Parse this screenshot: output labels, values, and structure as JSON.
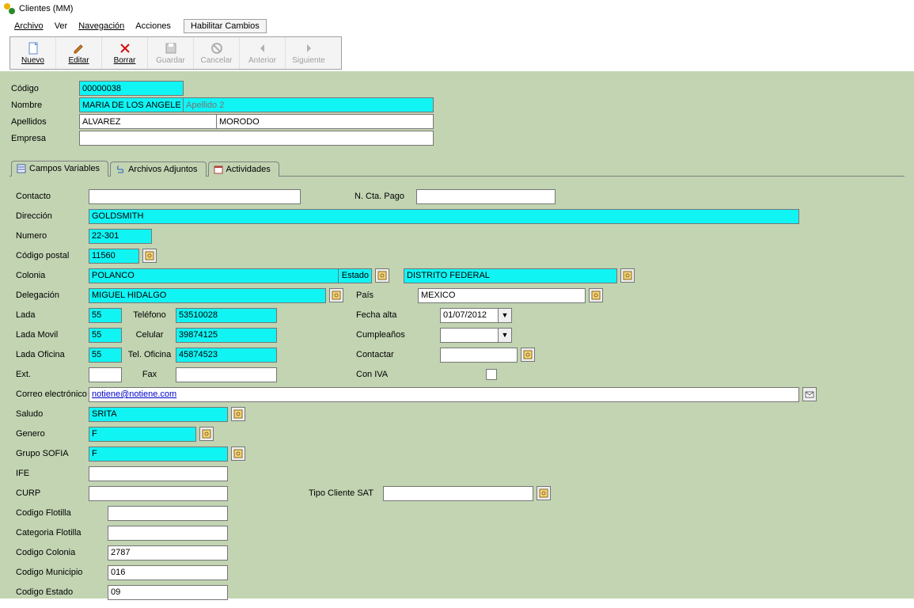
{
  "window": {
    "title": "Clientes (MM)"
  },
  "menu": {
    "archivo": "Archivo",
    "ver": "Ver",
    "navegacion": "Navegación",
    "acciones": "Acciones",
    "habilitar": "Habilitar Cambios"
  },
  "toolbar": {
    "nuevo": "Nuevo",
    "editar": "Editar",
    "borrar": "Borrar",
    "guardar": "Guardar",
    "cancelar": "Cancelar",
    "anterior": "Anterior",
    "siguiente": "Siguiente"
  },
  "header": {
    "codigo_label": "Código",
    "codigo": "00000038",
    "nombre_label": "Nombre",
    "nombre": "MARIA DE LOS ANGELES",
    "apellido2_ph": "Apellido 2",
    "apellidos_label": "Apellidos",
    "apellido1": "ALVAREZ",
    "apellido2": "MORODO",
    "empresa_label": "Empresa",
    "empresa": ""
  },
  "tabs": {
    "campos": "Campos Variables",
    "archivos": "Archivos Adjuntos",
    "actividades": "Actividades"
  },
  "fields": {
    "contacto_label": "Contacto",
    "contacto": "",
    "ncta_label": "N. Cta. Pago",
    "ncta": "",
    "direccion_label": "Dirección",
    "direccion": "GOLDSMITH",
    "numero_label": "Numero",
    "numero": "22-301",
    "cp_label": "Código postal",
    "cp": "11560",
    "colonia_label": "Colonia",
    "colonia": "POLANCO",
    "estado_label": "Estado",
    "estado": "DISTRITO FEDERAL",
    "delegacion_label": "Delegación",
    "delegacion": "MIGUEL HIDALGO",
    "pais_label": "País",
    "pais": "MEXICO",
    "lada_label": "Lada",
    "lada": "55",
    "telefono_label": "Teléfono",
    "telefono": "53510028",
    "fecha_label": "Fecha alta",
    "fecha": "01/07/2012",
    "ladamovil_label": "Lada Movil",
    "ladamovil": "55",
    "celular_label": "Celular",
    "celular": "39874125",
    "cumple_label": "Cumpleaños",
    "cumple": "",
    "ladaof_label": "Lada Oficina",
    "ladaof": "55",
    "telof_label": "Tel. Oficina",
    "telof": "45874523",
    "contactar_label": "Contactar",
    "contactar": "",
    "ext_label": "Ext.",
    "ext": "",
    "fax_label": "Fax",
    "fax": "",
    "iva_label": "Con IVA",
    "correo_label": "Correo electrónico",
    "correo": "notiene@notiene.com",
    "saludo_label": "Saludo",
    "saludo": "SRITA",
    "genero_label": "Genero",
    "genero": "F",
    "grupo_label": "Grupo SOFIA",
    "grupo": "F",
    "ife_label": "IFE",
    "ife": "",
    "curp_label": "CURP",
    "curp": "",
    "tiposat_label": "Tipo Cliente SAT",
    "tiposat": "",
    "codflot_label": "Codigo Flotilla",
    "codflot": "",
    "catflot_label": "Categoria Flotilla",
    "catflot": "",
    "codcol_label": "Codigo Colonia",
    "codcol": "2787",
    "codmun_label": "Codigo Municipio",
    "codmun": "016",
    "codest_label": "Codigo Estado",
    "codest": "09"
  }
}
